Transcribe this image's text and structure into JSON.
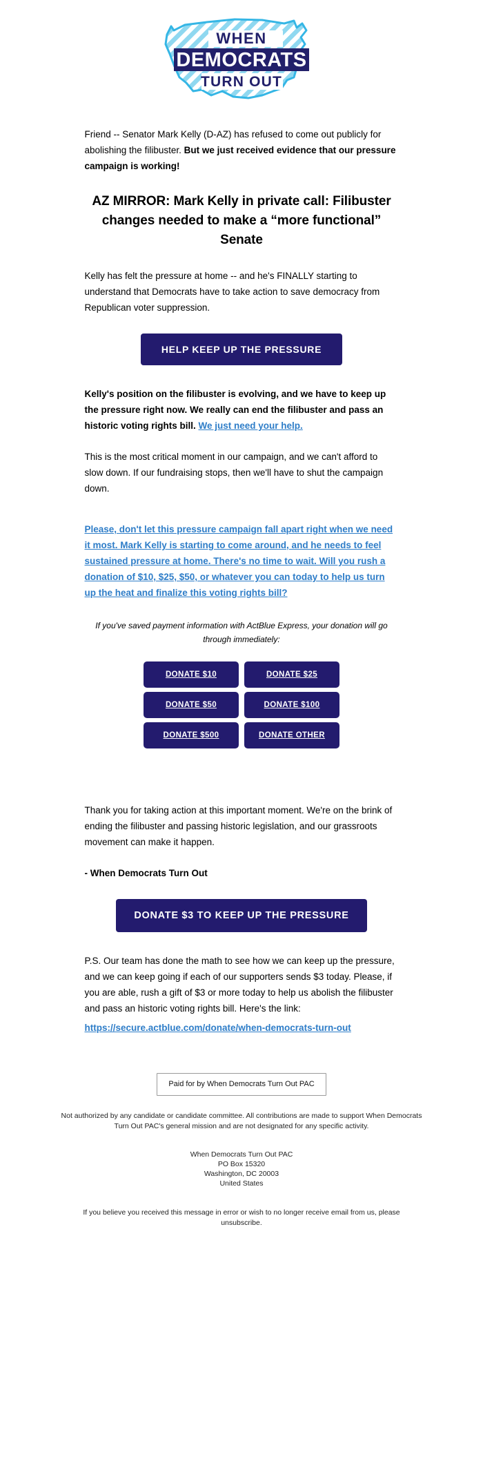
{
  "logo": {
    "line1": "WHEN",
    "line2": "DEMOCRATS",
    "line3": "TURN OUT",
    "map_stroke": "#35B6E5",
    "map_stripe": "#8FD8F0",
    "navy": "#22206A"
  },
  "intro": {
    "plain_1": "Friend -- Senator Mark Kelly (D-AZ) has refused to come out publicly for abolishing the filibuster. ",
    "bold_1": "But we just received evidence that our pressure campaign is working!"
  },
  "headline": "AZ MIRROR: Mark Kelly in private call: Filibuster changes needed to make a “more functional” Senate",
  "para_pressure": "Kelly has felt the pressure at home -- and he's FINALLY starting to understand that Democrats have to take action to save democracy from Republican voter suppression.",
  "cta_primary": "HELP KEEP UP THE PRESSURE",
  "para_evolving": {
    "bold_part": "Kelly's position on the filibuster is evolving, and we have to keep up the pressure right now. We really can end the filibuster and pass an historic voting rights bill. ",
    "link_part": "We just need your help."
  },
  "para_critical": "This is the most critical moment in our campaign, and we can't afford to slow down. If our fundraising stops, then we'll have to shut the campaign down.",
  "para_blue_link": "Please, don't let this pressure campaign fall apart right when we need it most. Mark Kelly is starting to come around, and he needs to feel sustained pressure at home. There's no time to wait. Will you rush a donation of $10, $25, $50, or whatever you can today to help us turn up the heat and finalize this voting rights bill?",
  "actblue_note": "If you've saved payment information with ActBlue Express, your donation will go through immediately:",
  "donate_buttons": [
    {
      "label": "DONATE $10"
    },
    {
      "label": "DONATE $25"
    },
    {
      "label": "DONATE $50"
    },
    {
      "label": "DONATE $100"
    },
    {
      "label": "DONATE $500"
    },
    {
      "label": "DONATE OTHER"
    }
  ],
  "para_thanks": "Thank you for taking action at this important moment. We're on the brink of ending the filibuster and passing historic legislation, and our grassroots movement can make it happen.",
  "signoff": "- When Democrats Turn Out",
  "cta_secondary": "DONATE $3 TO KEEP UP THE PRESSURE",
  "ps": {
    "text": "P.S. Our team has done the math to see how we can keep up the pressure, and we can keep going if each of our supporters sends $3 today. Please, if you are able, rush a gift of $3 or more today to help us abolish the filibuster and pass an historic voting rights bill. Here's the link:",
    "url": "https://secure.actblue.com/donate/when-democrats-turn-out"
  },
  "footer": {
    "paid_for": "Paid for by When Democrats Turn Out PAC",
    "disclaimer": "Not authorized by any candidate or candidate committee. All contributions are made to support When Democrats Turn Out PAC's general mission and are not designated for any specific activity.",
    "org": "When Democrats Turn Out PAC",
    "po_box": "PO Box 15320",
    "city": "Washington, DC 20003",
    "country": "United States",
    "unsubscribe": "If you believe you received this message in error or wish to no longer receive email from us, please unsubscribe."
  },
  "colors": {
    "navy_button": "#231B6E",
    "link_blue": "#2E7DC8",
    "logo_cyan": "#35B6E5"
  }
}
